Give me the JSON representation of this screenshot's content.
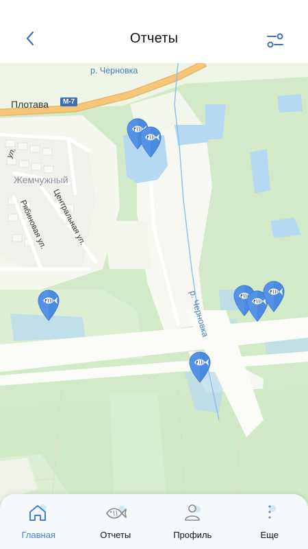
{
  "header": {
    "title": "Отчеты",
    "back_icon": "chevron-left-icon",
    "filter_icon": "filter-sliders-icon"
  },
  "map": {
    "labels": {
      "river_top": "р. Черновка",
      "village": "Плотава",
      "road_badge": "М-7",
      "district": "Жемчужный",
      "street_ul": "ул.",
      "street_central": "Центральная ул.",
      "street_ryabinovaya": "Рябиновая ул.",
      "river_mid": "р. Черновка"
    },
    "pin_icon": "fish-marker-icon",
    "colors": {
      "forest": "#cfe8c4",
      "field": "#f7f8f2",
      "water": "#b5d9f2",
      "highway": "#f6c77a",
      "pin": "#4a8be0"
    }
  },
  "tabbar": {
    "tabs": [
      {
        "label": "Главная",
        "icon": "home-icon",
        "active": true
      },
      {
        "label": "Отчеты",
        "icon": "fish-icon",
        "active": false
      },
      {
        "label": "Профиль",
        "icon": "user-icon",
        "active": false
      },
      {
        "label": "Еще",
        "icon": "more-vertical-icon",
        "active": false
      }
    ],
    "active_color": "#3f7fd6"
  }
}
